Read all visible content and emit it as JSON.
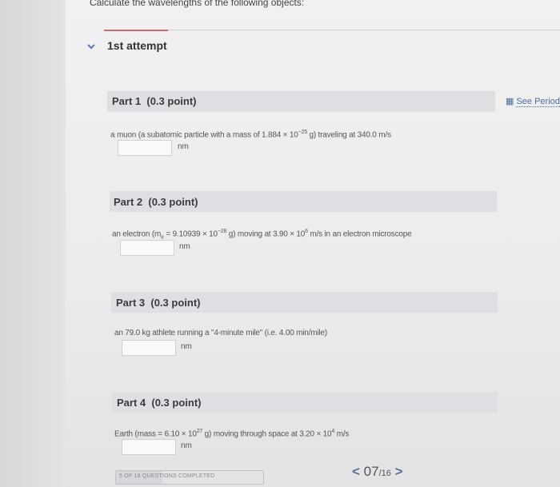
{
  "header": {
    "title": "Calculate the wavelengths of the following objects:"
  },
  "attempt": {
    "label": "1st attempt"
  },
  "periodic_link": {
    "label": "See Periodi"
  },
  "parts": [
    {
      "title": "Part 1",
      "points": "(0.3 point)",
      "q_pre": "a muon (a subatomic particle with a mass of 1.884 × 10",
      "q_exp1": "−25",
      "q_mid": " g) traveling at 340.0 m/s",
      "q_exp2": "",
      "q_post": "",
      "unit": "nm",
      "value": ""
    },
    {
      "title": "Part 2",
      "points": "(0.3 point)",
      "q_pre": "an electron (m",
      "q_sub": "e",
      "q_mid0": " = 9.10939 × 10",
      "q_exp1": "−28",
      "q_mid": " g) moving at 3.90 × 10",
      "q_exp2": "6",
      "q_post": " m/s in an electron microscope",
      "unit": "nm",
      "value": ""
    },
    {
      "title": "Part 3",
      "points": "(0.3 point)",
      "q_pre": "an 79.0 kg athlete running a \"4-minute mile\" (i.e. 4.00 min/mile)",
      "unit": "nm",
      "value": ""
    },
    {
      "title": "Part 4",
      "points": "(0.3 point)",
      "q_pre": "Earth (mass = 6.10 × 10",
      "q_exp1": "27",
      "q_mid": " g) moving through space at 3.20 × 10",
      "q_exp2": "4",
      "q_post": " m/s",
      "unit": "nm",
      "value": ""
    }
  ],
  "progress": {
    "label": "5 OF 16 QUESTIONS COMPLETED",
    "completed": 5,
    "total": 16
  },
  "pager": {
    "prev": "<",
    "current": "07",
    "total": "/16",
    "next": ">"
  },
  "colors": {
    "accent": "#5a79b6",
    "link": "#4e6d9c",
    "divider_red": "#c86b6b"
  }
}
